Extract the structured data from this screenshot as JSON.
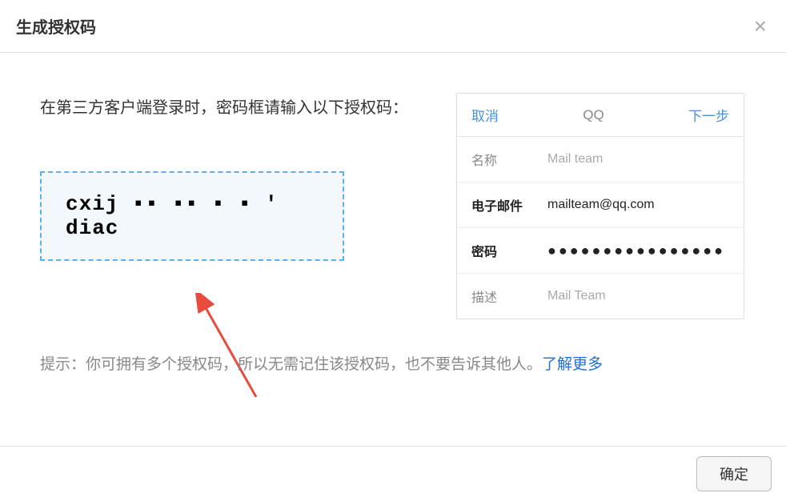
{
  "header": {
    "title": "生成授权码"
  },
  "body": {
    "instruction": "在第三方客户端登录时，密码框请输入以下授权码：",
    "auth_code": "cxij ▪▪ ▪▪  ▪ ▪ ' diac"
  },
  "preview": {
    "cancel": "取消",
    "title": "QQ",
    "next": "下一步",
    "rows": {
      "name_label": "名称",
      "name_value": "Mail team",
      "email_label": "电子邮件",
      "email_value": "mailteam@qq.com",
      "password_label": "密码",
      "password_value": "●●●●●●●●●●●●●●●●",
      "desc_label": "描述",
      "desc_value": "Mail Team"
    }
  },
  "hint": {
    "label": "提示：",
    "text": "你可拥有多个授权码，所以无需记住该授权码，也不要告诉其他人。",
    "link": "了解更多"
  },
  "footer": {
    "ok": "确定"
  }
}
